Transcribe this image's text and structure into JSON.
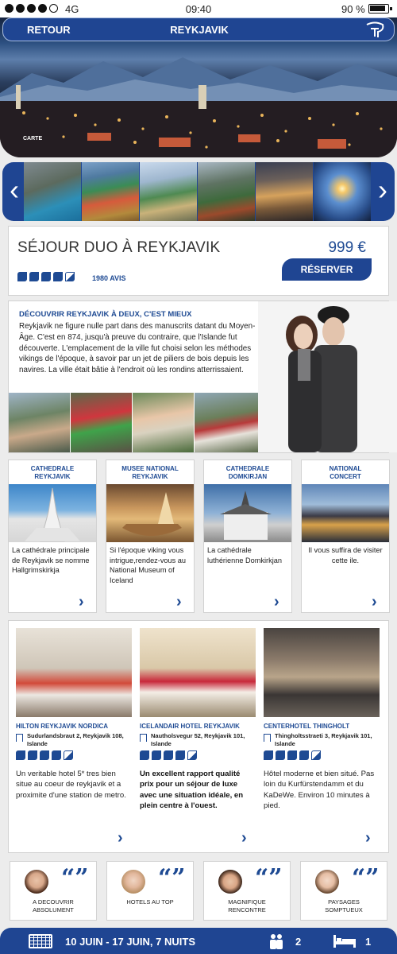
{
  "status_bar": {
    "network": "4G",
    "time": "09:40",
    "battery": "90 %"
  },
  "nav": {
    "back_label": "RETOUR",
    "title": "REYKJAVIK",
    "logo_icon": "brand-logo-icon"
  },
  "hero": {
    "map_label": "CARTE"
  },
  "gallery": {
    "prev_icon": "chevron-left-icon",
    "next_icon": "chevron-right-icon"
  },
  "booking": {
    "name": "SÉJOUR DUO À REYKJAVIK",
    "price": "999 €",
    "rating": 4.5,
    "reviews": "1980 AVIS",
    "reserve_label": "RÉSERVER"
  },
  "discover": {
    "heading": "DÉCOUVRIR REYKJAVIK À DEUX, C'EST MIEUX",
    "text": "Reykjavik ne figure nulle part dans des manuscrits datant du Moyen-Âge. C'est en 874, jusqu'à preuve du contraire, que l'Islande fut découverte. L'emplacement de la ville fut choisi selon les méthodes vikings de l'époque, à savoir par un jet de piliers de bois depuis les navires. La ville était bâtie à l'endroit où les rondins atterrissaient."
  },
  "attractions": [
    {
      "title": "CATHEDRALE\nREYKJAVIK",
      "desc": "La cathédrale principale de Reykjavik se nomme Hallgrimskirkja"
    },
    {
      "title": "MUSEE NATIONAL\nREYKJAVIK",
      "desc": "Si l'époque viking vous intrigue,rendez-vous au National Museum of Iceland"
    },
    {
      "title": "CATHEDRALE\nDOMKIRJAN",
      "desc": "La  cathédrale luthérienne Domkirkjan"
    },
    {
      "title": "NATIONAL\nCONCERT",
      "desc": "Il vous suffira de visiter cette ile."
    }
  ],
  "hotels": [
    {
      "name": "HILTON REYKJAVIK NORDICA",
      "address": "Sudurlandsbraut 2, Reykjavik 108, Islande",
      "rating": 4.5,
      "desc": "Un veritable hotel 5* tres bien situe au coeur de reykjavik et a proximite d'une station de metro."
    },
    {
      "name": "ICELANDAIR HOTEL REYKJAVIK",
      "address": "Nautholsvegur 52, Reykjavik 101, Islande",
      "rating": 4.5,
      "desc": "Un excellent rapport qualité prix pour un séjour de luxe avec une situation idéale, en plein centre à l'ouest."
    },
    {
      "name": "CENTERHOTEL THINGHOLT",
      "address": "Thingholtsstraeti 3, Reykjavik 101, Islande",
      "rating": 4.5,
      "desc": "Hôtel moderne et bien situé. Pas loin du Kurfürstendamm et du KaDeWe. Environ 10 minutes à pied."
    }
  ],
  "testimonials": [
    {
      "label": "A DECOUVRIR\nABSOLUMENT"
    },
    {
      "label": "HOTELS AU TOP"
    },
    {
      "label": "MAGNIFIQUE\nRENCONTRE"
    },
    {
      "label": "PAYSAGES\nSOMPTUEUX"
    }
  ],
  "bottom": {
    "dates": "10 JUIN - 17 JUIN, 7 NUITS",
    "people": "2",
    "rooms": "1"
  },
  "colors": {
    "primary": "#1f4592",
    "accent": "#1e4a93",
    "background": "#ececec"
  }
}
